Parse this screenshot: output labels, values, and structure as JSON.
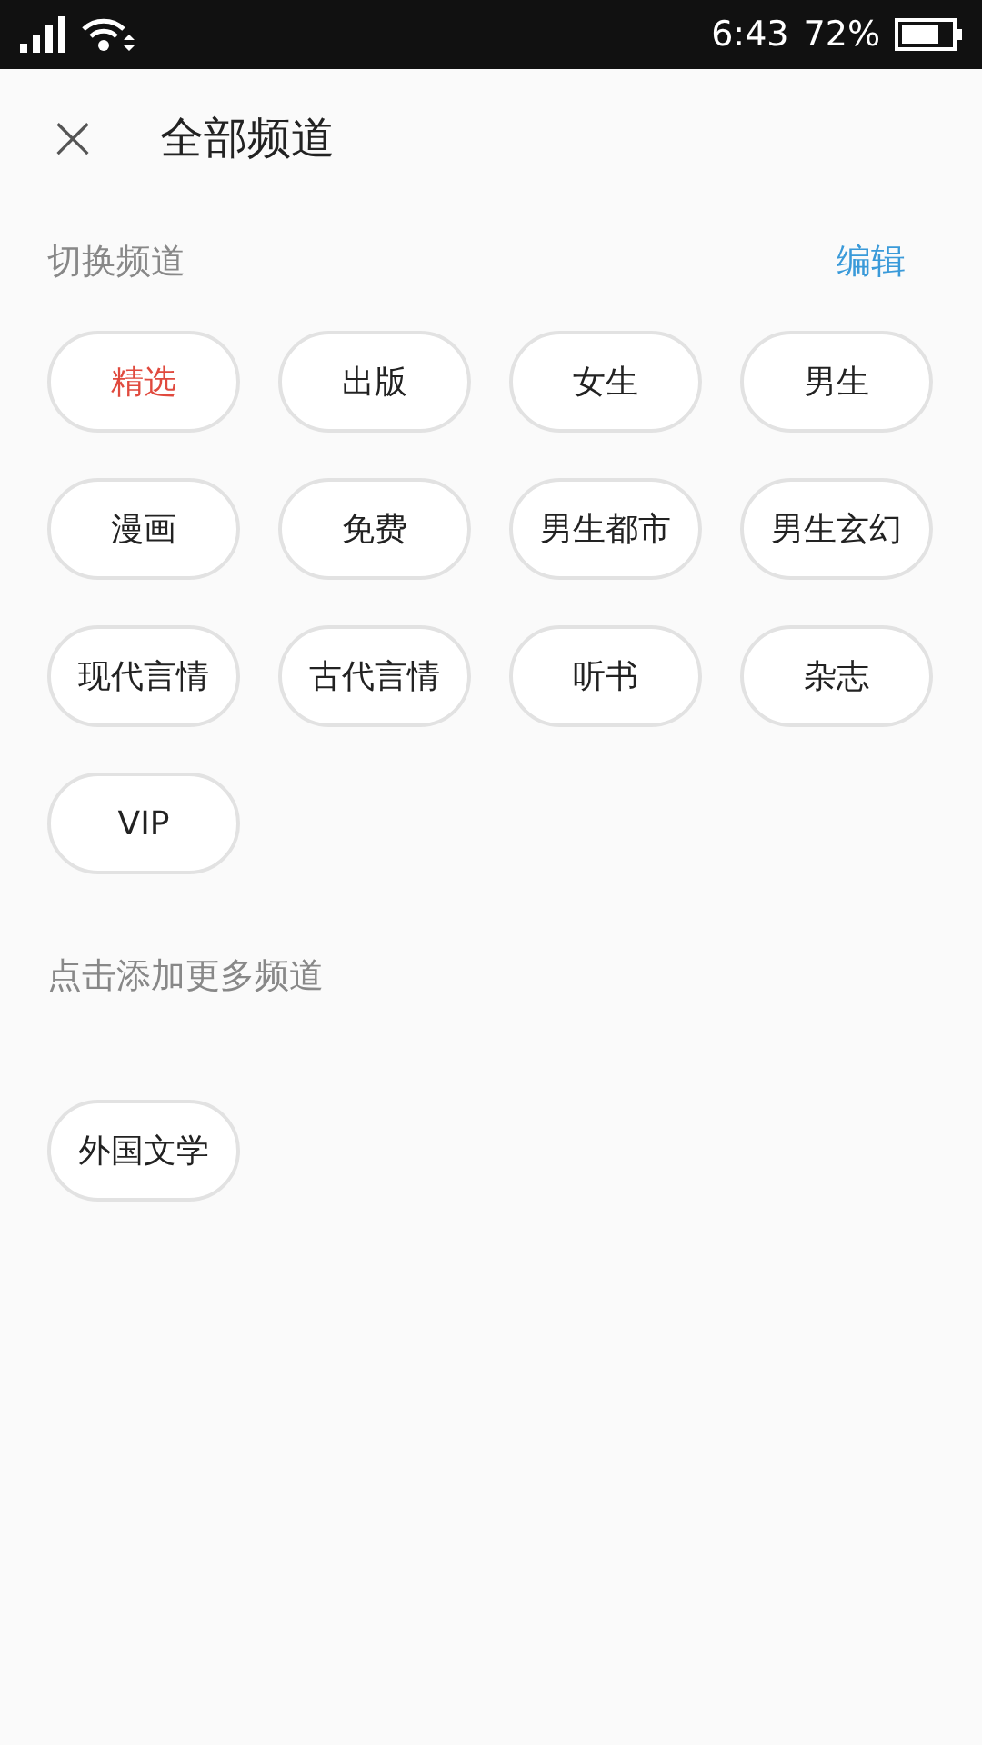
{
  "status_bar": {
    "time": "6:43",
    "battery": "72%"
  },
  "header": {
    "close_icon": "×",
    "title": "全部频道"
  },
  "my_channels": {
    "title": "切换频道",
    "action": "编辑",
    "items": [
      {
        "label": "精选",
        "selected": true
      },
      {
        "label": "出版",
        "selected": false
      },
      {
        "label": "女生",
        "selected": false
      },
      {
        "label": "男生",
        "selected": false
      },
      {
        "label": "漫画",
        "selected": false
      },
      {
        "label": "免费",
        "selected": false
      },
      {
        "label": "男生都市",
        "selected": false
      },
      {
        "label": "男生玄幻",
        "selected": false
      },
      {
        "label": "现代言情",
        "selected": false
      },
      {
        "label": "古代言情",
        "selected": false
      },
      {
        "label": "听书",
        "selected": false
      },
      {
        "label": "杂志",
        "selected": false
      },
      {
        "label": "VIP",
        "selected": false
      }
    ]
  },
  "more_channels": {
    "title": "点击添加更多频道",
    "items": [
      {
        "label": "外国文学"
      }
    ]
  }
}
